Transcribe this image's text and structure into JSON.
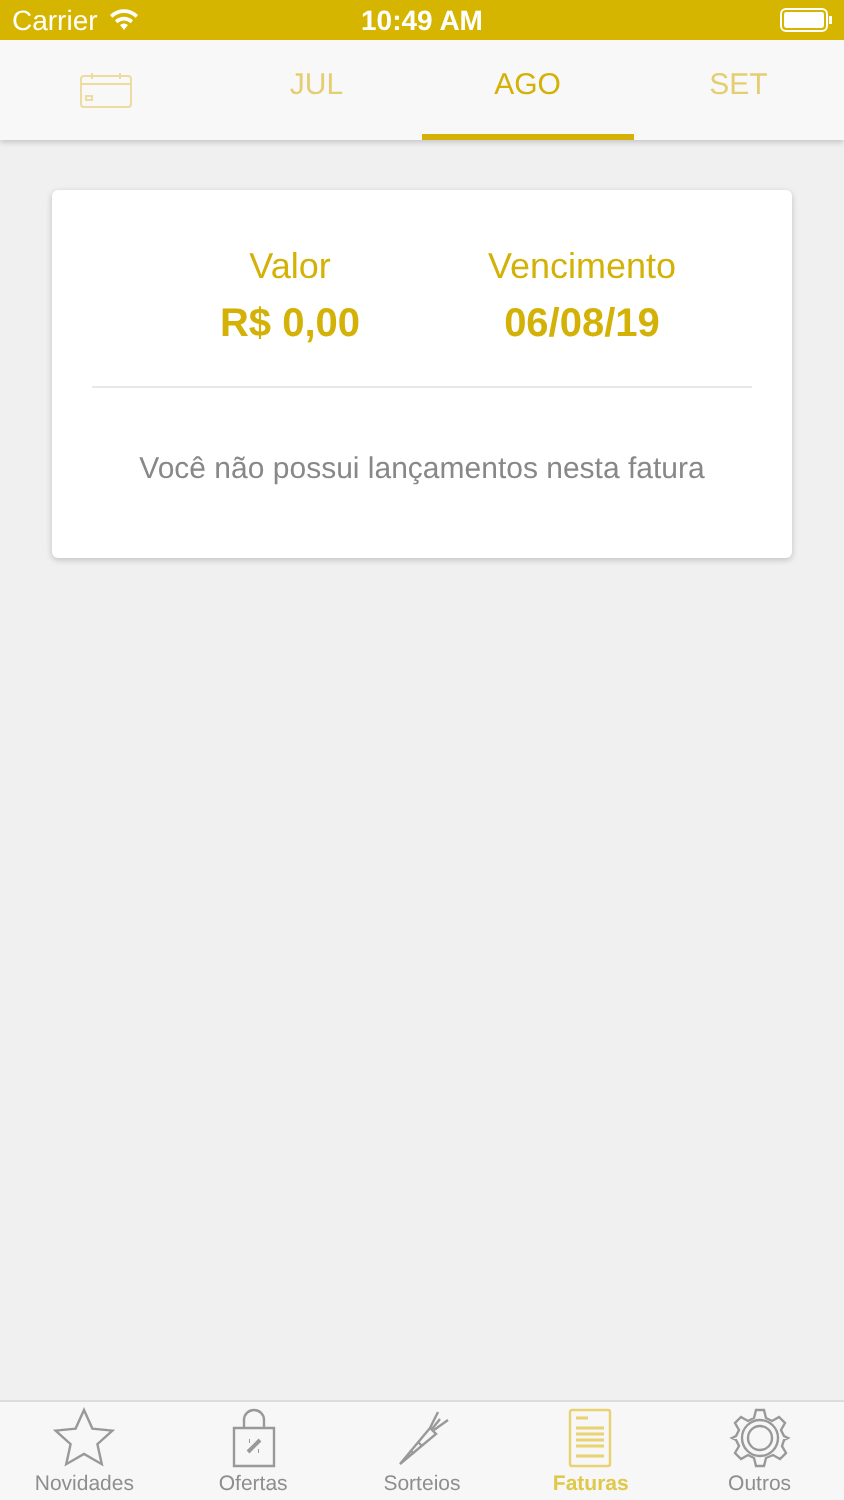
{
  "status_bar": {
    "carrier": "Carrier",
    "time": "10:49 AM"
  },
  "month_tabs": [
    {
      "label": "JUL",
      "selected": false
    },
    {
      "label": "AGO",
      "selected": true
    },
    {
      "label": "SET",
      "selected": false
    }
  ],
  "invoice": {
    "amount_label": "Valor",
    "amount": "R$ 0,00",
    "due_label": "Vencimento",
    "due_date": "06/08/19",
    "message": "Você não possui lançamentos nesta fatura"
  },
  "tab_bar": [
    {
      "label": "Novidades",
      "kind": "star",
      "selected": false
    },
    {
      "label": "Ofertas",
      "kind": "bag",
      "selected": false
    },
    {
      "label": "Sorteios",
      "kind": "carrot",
      "selected": false
    },
    {
      "label": "Faturas",
      "kind": "invoice",
      "selected": true
    },
    {
      "label": "Outros",
      "kind": "gear",
      "selected": false
    }
  ]
}
